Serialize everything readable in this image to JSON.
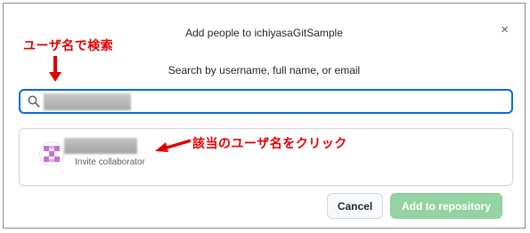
{
  "dialog": {
    "title": "Add people to ichiyasaGitSample",
    "close_glyph": "×",
    "subtitle": "Search by username, full name, or email"
  },
  "search": {
    "value": "",
    "icon": "search-icon"
  },
  "result": {
    "name": "",
    "role_text": "Invite collaborator",
    "avatar": "identicon-avatar"
  },
  "annotations": {
    "top_label": "ユーザ名で検索",
    "right_label": "該当のユーザ名をクリック",
    "color": "#e00000"
  },
  "buttons": {
    "cancel_label": "Cancel",
    "add_label": "Add to repository"
  },
  "colors": {
    "focus_border": "#0969da",
    "add_button_disabled": "#94d3a2"
  }
}
